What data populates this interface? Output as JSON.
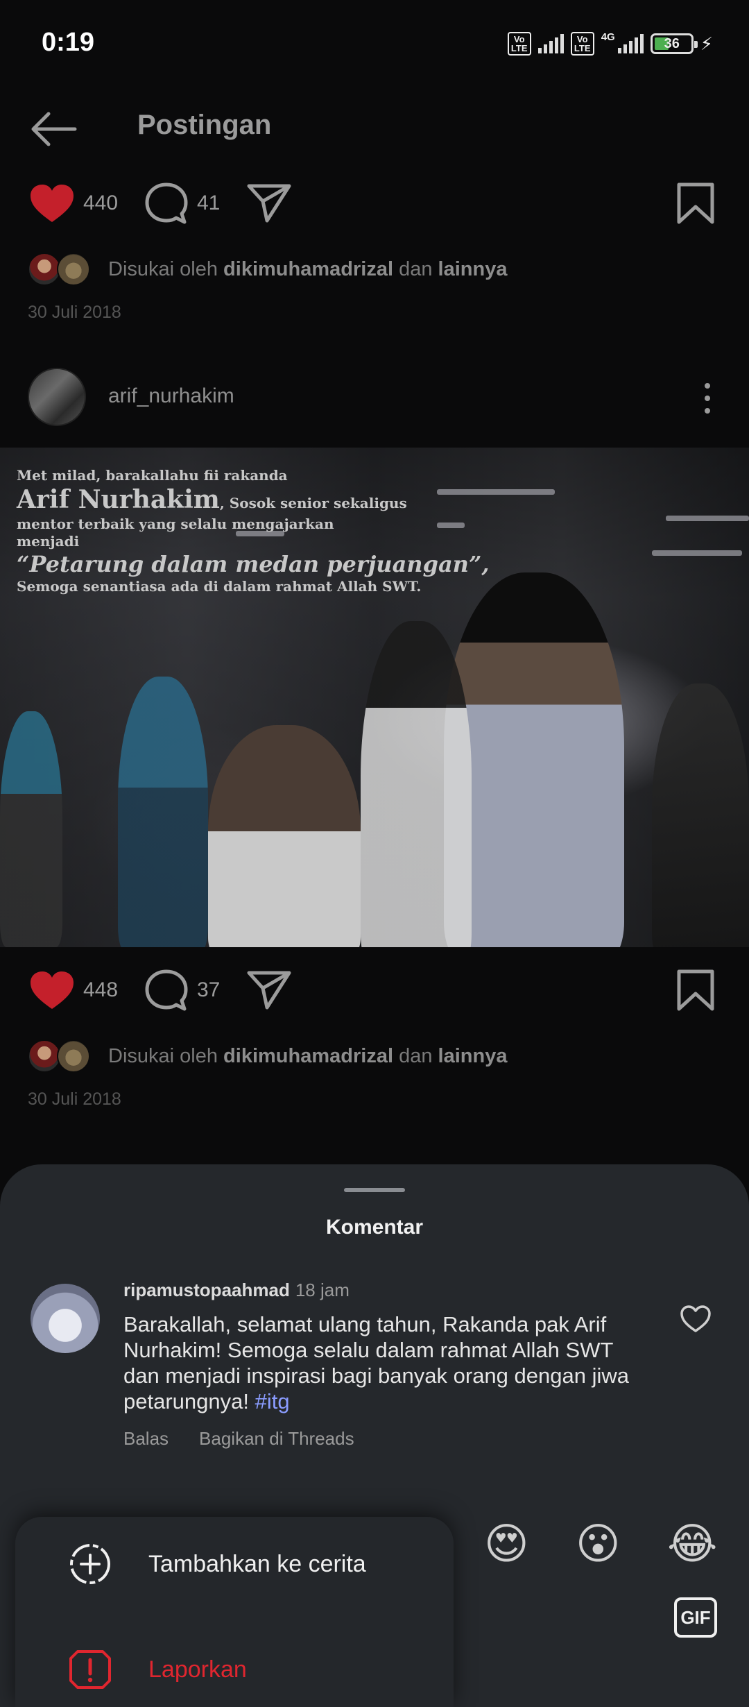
{
  "status": {
    "time": "0:19",
    "net1": "VoLTE",
    "net2": "VoLTE",
    "net_type": "4G",
    "battery": "36"
  },
  "topbar": {
    "title": "Postingan"
  },
  "post1": {
    "likes": "440",
    "comments": "41",
    "liked_by_prefix": "Disukai oleh",
    "liked_by_user": "dikimuhamadrizal",
    "liked_by_and": "dan",
    "liked_by_others": "lainnya",
    "date": "30 Juli 2018"
  },
  "post2": {
    "username": "arif_nurhakim",
    "image_text": {
      "line1": "Met milad, barakallahu fii rakanda",
      "name": "Arif Nurhakim",
      "line2": ", Sosok senior sekaligus",
      "line3": "mentor terbaik yang selalu mengajarkan",
      "line4": "menjadi",
      "quote": "“Petarung dalam medan perjuangan”,",
      "line5": "Semoga senantiasa ada di dalam rahmat Allah SWT."
    },
    "likes": "448",
    "comments": "37",
    "liked_by_prefix": "Disukai oleh",
    "liked_by_user": "dikimuhamadrizal",
    "liked_by_and": "dan",
    "liked_by_others": "lainnya",
    "date": "30 Juli 2018"
  },
  "comments_sheet": {
    "title": "Komentar",
    "comment": {
      "username": "ripamustopaahmad",
      "time": "18 jam",
      "text": "Barakallah, selamat ulang tahun, Rakanda pak Arif Nurhakim! Semoga selalu dalam rahmat Allah SWT dan menjadi inspirasi bagi banyak orang dengan jiwa petarungnya!",
      "hashtag": "#itg",
      "reply_label": "Balas",
      "share_label": "Bagikan di Threads"
    },
    "emojis": [
      "😍",
      "😮",
      "😂"
    ],
    "gif_label": "GIF"
  },
  "popup_menu": {
    "add_story": "Tambahkan ke cerita",
    "report": "Laporkan",
    "report_color": "#e0262f"
  },
  "colors": {
    "heart": "#c4202b",
    "accent_link": "#8a9cff",
    "sheet_bg": "#25282c"
  }
}
